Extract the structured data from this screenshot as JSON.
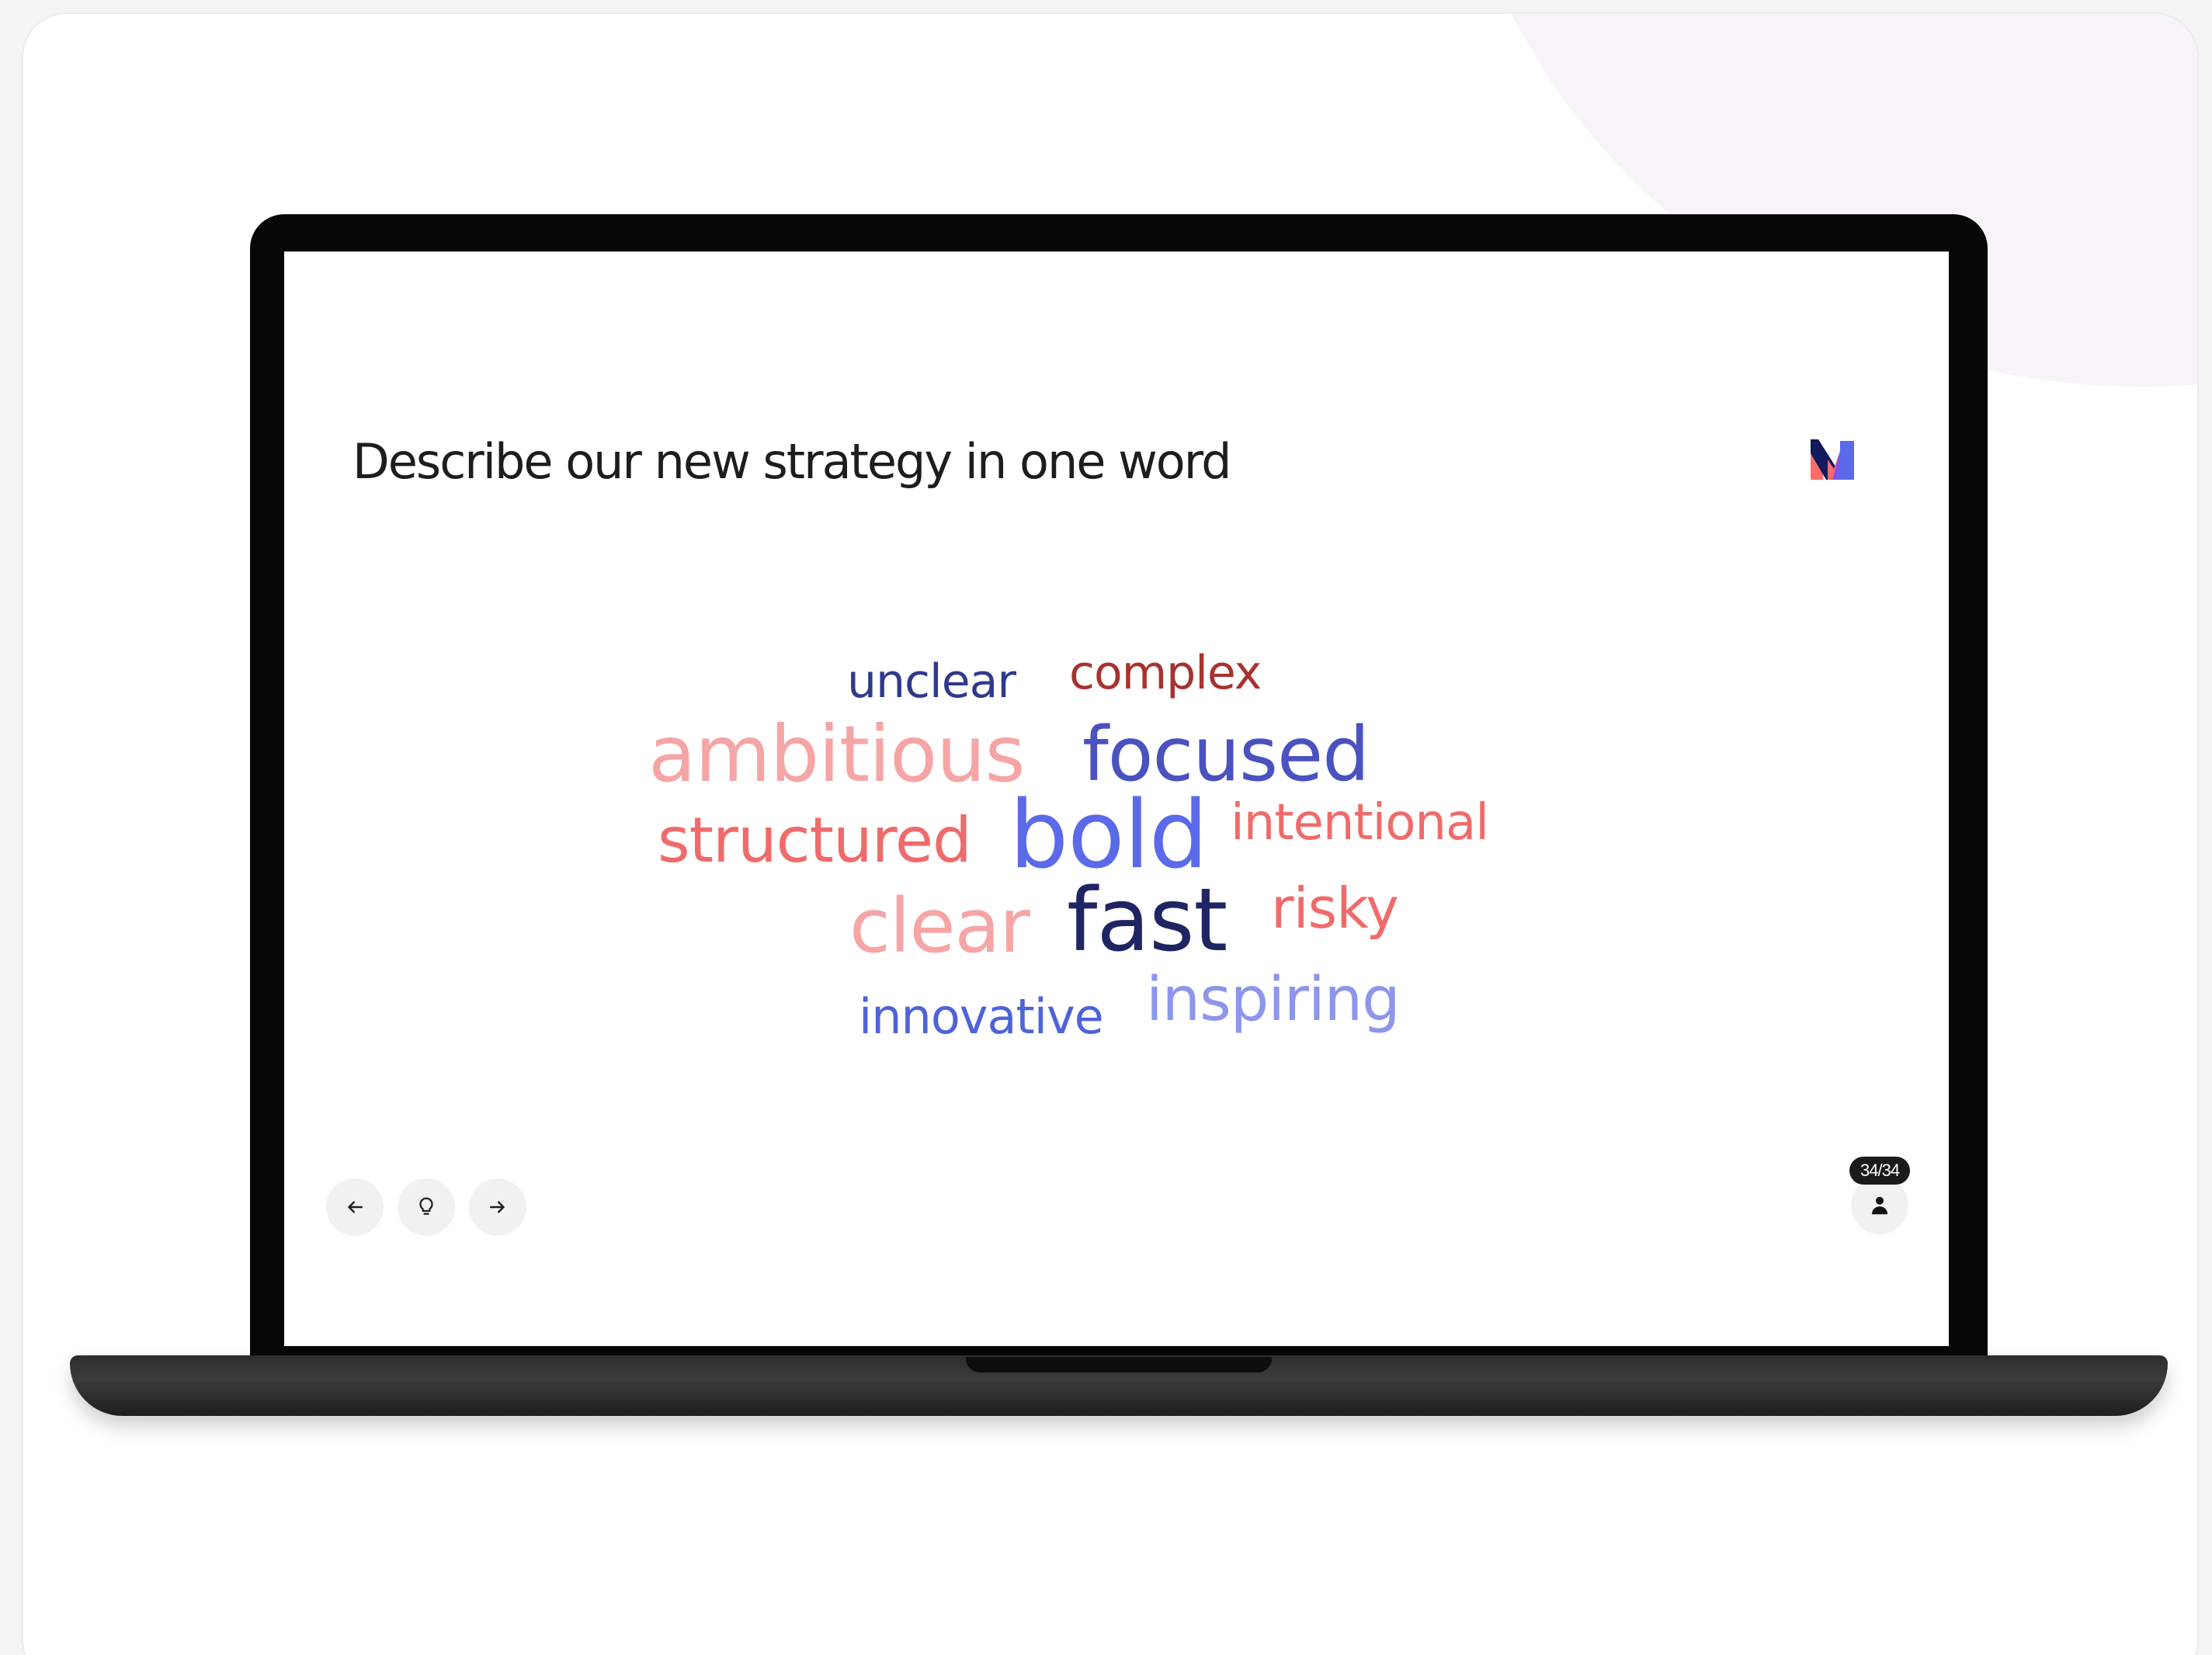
{
  "presentation": {
    "question": "Describe our new strategy in one word",
    "logo_icon": "mentimeter-logo-icon",
    "word_cloud": [
      {
        "text": "unclear",
        "color": "#2f3a8c"
      },
      {
        "text": "complex",
        "color": "#a8322f"
      },
      {
        "text": "ambitious",
        "color": "#f5a5a5"
      },
      {
        "text": "focused",
        "color": "#4a52c0"
      },
      {
        "text": "structured",
        "color": "#ef6b6b"
      },
      {
        "text": "bold",
        "color": "#5a6ae8"
      },
      {
        "text": "intentional",
        "color": "#ef6b6b"
      },
      {
        "text": "clear",
        "color": "#f5a5a5"
      },
      {
        "text": "fast",
        "color": "#1f2462"
      },
      {
        "text": "risky",
        "color": "#ef6b6b"
      },
      {
        "text": "innovative",
        "color": "#4f63d8"
      },
      {
        "text": "inspiring",
        "color": "#8d96ec"
      }
    ]
  },
  "controls": {
    "previous_icon": "arrow-left-icon",
    "hint_icon": "lightbulb-icon",
    "next_icon": "arrow-right-icon"
  },
  "participants": {
    "count": "34/34",
    "icon": "person-icon"
  }
}
